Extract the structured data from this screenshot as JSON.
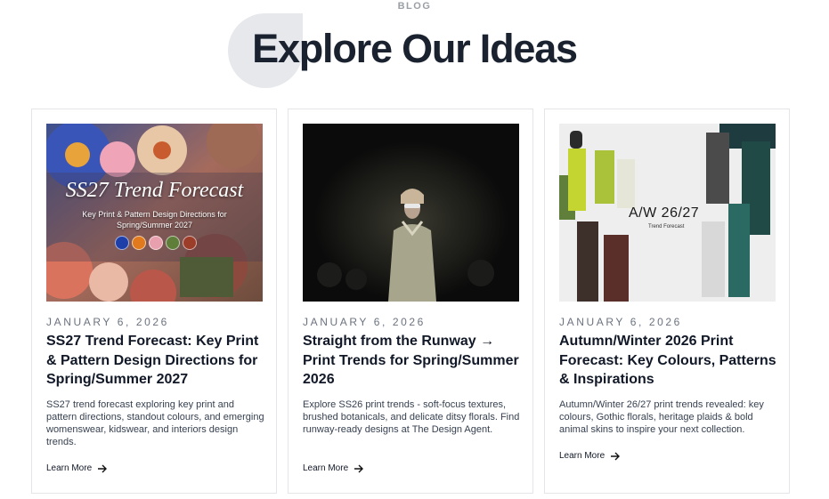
{
  "header": {
    "eyebrow": "BLOG",
    "title": "Explore Our Ideas"
  },
  "posts": [
    {
      "date": "JANUARY 6, 2026",
      "title": "SS27 Trend Forecast: Key Print & Pattern Design Directions for Spring/Summer 2027",
      "description": "SS27 trend forecast exploring key print and pattern directions, standout colours, and emerging womenswear, kidswear, and interiors design trends.",
      "link_label": "Learn More",
      "image": {
        "overlay_title": "SS27 Trend Forecast",
        "overlay_subtitle": "Key Print & Pattern Design Directions for Spring/Summer 2027",
        "swatch_colors": [
          "#1f3fa8",
          "#e07a1c",
          "#e8a0ae",
          "#5e7e3a",
          "#9c3d2a"
        ]
      }
    },
    {
      "date": "JANUARY 6, 2026",
      "title": "Straight from the Runway → Print Trends for Spring/Summer 2026",
      "description": "Explore SS26 print trends - soft-focus textures, brushed botanicals, and delicate ditsy florals. Find runway-ready designs at The Design Agent.",
      "link_label": "Learn More"
    },
    {
      "date": "JANUARY 6, 2026",
      "title": "Autumn/Winter 2026 Print Forecast: Key Colours, Patterns & Inspirations",
      "description": "Autumn/Winter 26/27 print trends revealed: key colours, Gothic florals, heritage plaids & bold animal skins to inspire your next collection.",
      "link_label": "Learn More",
      "image": {
        "overlay_title": "A/W 26/27",
        "overlay_subtitle": "Trend Forecast"
      }
    }
  ]
}
